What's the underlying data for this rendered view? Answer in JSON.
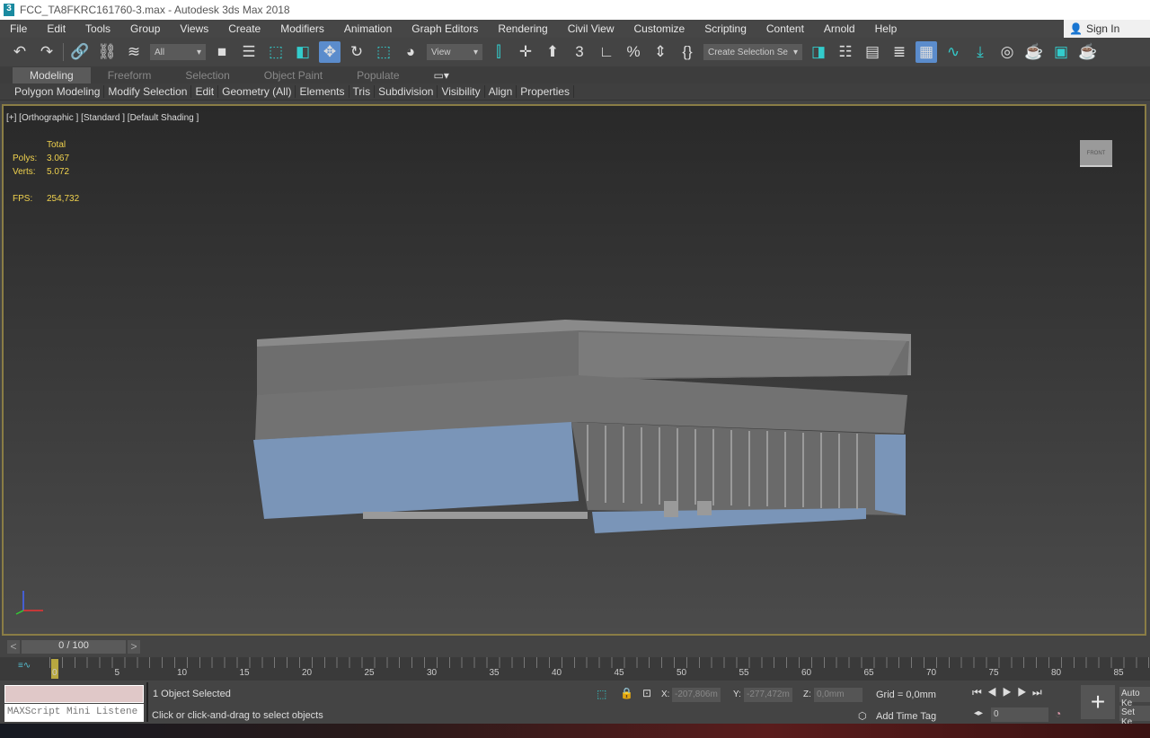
{
  "title": "FCC_TA8FKRC161760-3.max - Autodesk 3ds Max 2018",
  "menu": [
    "File",
    "Edit",
    "Tools",
    "Group",
    "Views",
    "Create",
    "Modifiers",
    "Animation",
    "Graph Editors",
    "Rendering",
    "Civil View",
    "Customize",
    "Scripting",
    "Content",
    "Arnold",
    "Help"
  ],
  "sign_in": "Sign In",
  "toolbar": {
    "filter": "All",
    "ref_coord": "View",
    "selection_set": "Create Selection Se"
  },
  "ribbon_tabs": [
    "Modeling",
    "Freeform",
    "Selection",
    "Object Paint",
    "Populate"
  ],
  "ribbon_panels": [
    "Polygon Modeling",
    "Modify Selection",
    "Edit",
    "Geometry (All)",
    "Elements",
    "Tris",
    "Subdivision",
    "Visibility",
    "Align",
    "Properties"
  ],
  "viewport": {
    "label": "[+] [Orthographic ] [Standard ] [Default Shading ]",
    "stats_header": "Total",
    "polys_label": "Polys:",
    "polys": "3.067",
    "verts_label": "Verts:",
    "verts": "5.072",
    "fps_label": "FPS:",
    "fps": "254,732",
    "viewcube": "FRONT"
  },
  "timeline": {
    "frame": "0 / 100",
    "prev": "<",
    "next": ">",
    "ticks": [
      "0",
      "5",
      "10",
      "15",
      "20",
      "25",
      "30",
      "35",
      "40",
      "45",
      "50",
      "55",
      "60",
      "65",
      "70",
      "75",
      "80",
      "85"
    ]
  },
  "status": {
    "listener": "MAXScript Mini Listene",
    "selected": "1 Object Selected",
    "prompt": "Click or click-and-drag to select objects",
    "x_label": "X:",
    "x": "-207,806m",
    "y_label": "Y:",
    "y": "-277,472m",
    "z_label": "Z:",
    "z": "0,0mm",
    "grid": "Grid = 0,0mm",
    "add_time_tag": "Add Time Tag",
    "frame_field": "0",
    "auto_key": "Auto Ke",
    "set_key": "Set Ke"
  }
}
